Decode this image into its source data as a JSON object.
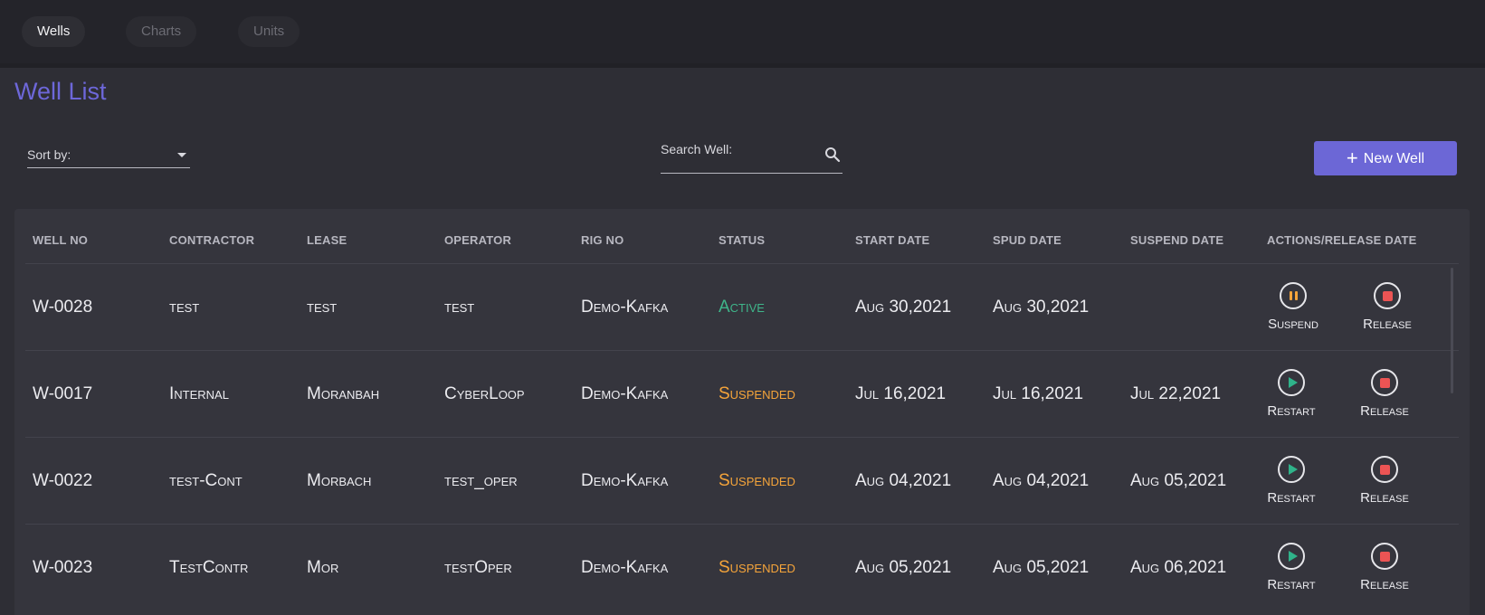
{
  "nav": {
    "tabs": [
      {
        "label": "Wells",
        "active": true
      },
      {
        "label": "Charts",
        "active": false
      },
      {
        "label": "Units",
        "active": false
      }
    ]
  },
  "page": {
    "title": "Well List",
    "sort_label": "Sort by:",
    "search_label": "Search Well:",
    "new_button_label": "New Well",
    "new_button_icon": "plus-icon"
  },
  "colors": {
    "accent": "#6c67d6",
    "active": "#3fb58a",
    "suspended": "#f5a43a",
    "release": "#ec5454"
  },
  "table": {
    "columns": [
      "WELL NO",
      "CONTRACTOR",
      "LEASE",
      "OPERATOR",
      "RIG NO",
      "STATUS",
      "START DATE",
      "SPUD DATE",
      "SUSPEND DATE",
      "ACTIONS/RELEASE DATE"
    ],
    "rows": [
      {
        "well_no": "W-0028",
        "contractor": "test",
        "lease": "test",
        "operator": "test",
        "rig_no": "Demo-Kafka",
        "status": "Active",
        "start_date": "Aug 30,2021",
        "spud_date": "Aug 30,2021",
        "suspend_date": "",
        "action1": {
          "label": "Suspend",
          "icon": "pause-icon"
        },
        "action2": {
          "label": "Release",
          "icon": "stop-icon"
        }
      },
      {
        "well_no": "W-0017",
        "contractor": "Internal",
        "lease": "Moranbah",
        "operator": "CyberLoop",
        "rig_no": "Demo-Kafka",
        "status": "Suspended",
        "start_date": "Jul 16,2021",
        "spud_date": "Jul 16,2021",
        "suspend_date": "Jul 22,2021",
        "action1": {
          "label": "Restart",
          "icon": "play-icon"
        },
        "action2": {
          "label": "Release",
          "icon": "stop-icon"
        }
      },
      {
        "well_no": "W-0022",
        "contractor": "test-Cont",
        "lease": "Morbach",
        "operator": "test_oper",
        "rig_no": "Demo-Kafka",
        "status": "Suspended",
        "start_date": "Aug 04,2021",
        "spud_date": "Aug 04,2021",
        "suspend_date": "Aug 05,2021",
        "action1": {
          "label": "Restart",
          "icon": "play-icon"
        },
        "action2": {
          "label": "Release",
          "icon": "stop-icon"
        }
      },
      {
        "well_no": "W-0023",
        "contractor": "TestContr",
        "lease": "Mor",
        "operator": "testOper",
        "rig_no": "Demo-Kafka",
        "status": "Suspended",
        "start_date": "Aug 05,2021",
        "spud_date": "Aug 05,2021",
        "suspend_date": "Aug 06,2021",
        "action1": {
          "label": "Restart",
          "icon": "play-icon"
        },
        "action2": {
          "label": "Release",
          "icon": "stop-icon"
        }
      }
    ]
  }
}
